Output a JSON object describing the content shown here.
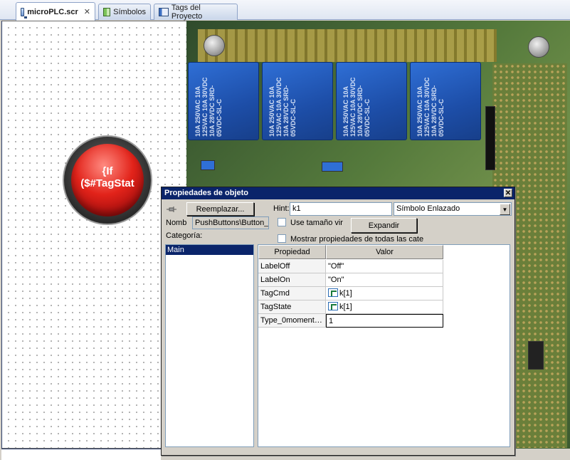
{
  "tabs": [
    {
      "label": "microPLC.scr",
      "close": "✕"
    },
    {
      "label": "Símbolos"
    },
    {
      "label": "Tags del Proyecto"
    }
  ],
  "symbol": {
    "label": "{If\n($#TagStat"
  },
  "board_relays": [
    "10A 250VAC 10A 125VAC 10A 30VDC 10A 28VDC SRD-05VDC-SL-C",
    "10A 250VAC 10A 125VAC 10A 30VDC 10A 28VDC SRD-05VDC-SL-C",
    "10A 250VAC 10A 125VAC 10A 30VDC 10A 28VDC SRD-05VDC-SL-C",
    "10A 250VAC 10A 125VAC 10A 30VDC 10A 28VDC SRD-05VDC-SL-C"
  ],
  "dialog": {
    "title": "Propiedades de objeto",
    "close": "✕",
    "replace_button": "Reemplazar...",
    "hint_label": "Hint:",
    "hint_value": "k1",
    "linked_symbol": "Símbolo Enlazado",
    "name_label": "Nomb",
    "name_value": "PushButtons\\Button_",
    "virtual_size_label": "Use tamaño vir",
    "expand_button": "Expandir",
    "show_all_label": "Mostrar propiedades de todas las cate",
    "category_label": "Categoría:",
    "categories": [
      "Main"
    ],
    "grid_headers": {
      "property": "Propiedad",
      "value": "Valor"
    },
    "rows": [
      {
        "name": "LabelOff",
        "value": "\"Off\"",
        "tag": false
      },
      {
        "name": "LabelOn",
        "value": "\"On\"",
        "tag": false
      },
      {
        "name": "TagCmd",
        "value": "k[1]",
        "tag": true
      },
      {
        "name": "TagState",
        "value": "k[1]",
        "tag": true
      },
      {
        "name": "Type_0moment…",
        "value": "1",
        "tag": false
      }
    ]
  }
}
